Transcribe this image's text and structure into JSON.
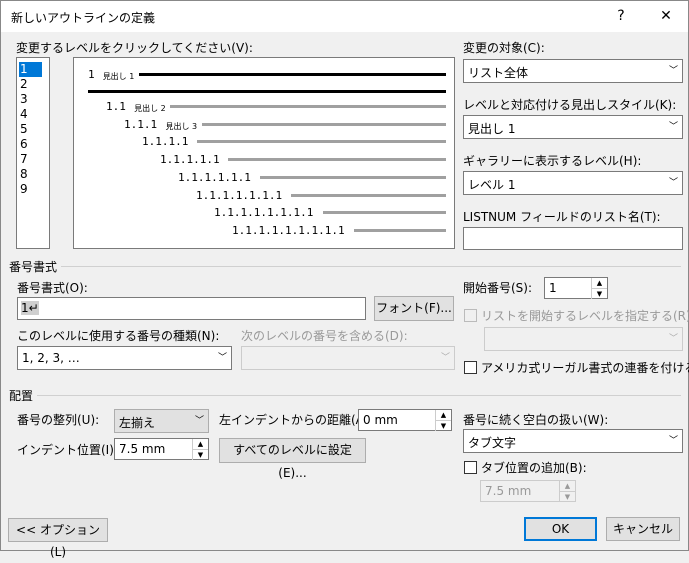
{
  "window": {
    "title": "新しいアウトラインの定義",
    "help_label": "?",
    "close_label": "✕"
  },
  "level_select": {
    "label": "変更するレベルをクリックしてください(V):",
    "levels": [
      "1",
      "2",
      "3",
      "4",
      "5",
      "6",
      "7",
      "8",
      "9"
    ]
  },
  "preview": {
    "rows": [
      {
        "num": "1",
        "head": "見出し 1",
        "style": "black"
      },
      {
        "num": "1.1",
        "head": "見出し 2",
        "style": "gray"
      },
      {
        "num": "1.1.1",
        "head": "見出し 3",
        "style": "gray"
      },
      {
        "num": "1.1.1.1",
        "head": "",
        "style": "gray"
      },
      {
        "num": "1.1.1.1.1",
        "head": "",
        "style": "gray"
      },
      {
        "num": "1.1.1.1.1.1",
        "head": "",
        "style": "gray"
      },
      {
        "num": "1.1.1.1.1.1.1",
        "head": "",
        "style": "gray"
      },
      {
        "num": "1.1.1.1.1.1.1.1",
        "head": "",
        "style": "gray"
      },
      {
        "num": "1.1.1.1.1.1.1.1.1",
        "head": "",
        "style": "gray"
      }
    ]
  },
  "right_panel": {
    "apply_to_label": "変更の対象(C):",
    "apply_to_value": "リスト全体",
    "link_style_label": "レベルと対応付ける見出しスタイル(K):",
    "link_style_value": "見出し 1",
    "gallery_level_label": "ギャラリーに表示するレベル(H):",
    "gallery_level_value": "レベル 1",
    "listnum_label": "LISTNUM フィールドのリスト名(T):",
    "listnum_value": ""
  },
  "number_format": {
    "group_label": "番号書式",
    "format_label": "番号書式(O):",
    "format_value": "1↵",
    "font_button": "フォント(F)...",
    "style_label": "このレベルに使用する番号の種類(N):",
    "style_value": "1, 2, 3, …",
    "include_label": "次のレベルの番号を含める(D):",
    "include_value": "",
    "start_label": "開始番号(S):",
    "start_value": "1",
    "restart_label": "リストを開始するレベルを指定する(R):",
    "restart_value": "",
    "legal_label": "アメリカ式リーガル書式の連番を付ける(G)"
  },
  "position": {
    "group_label": "配置",
    "align_label": "番号の整列(U):",
    "align_value": "左揃え",
    "indent_at_label": "左インデントからの距離(A):",
    "indent_at_value": "0 mm",
    "text_indent_label": "インデント位置(I):",
    "text_indent_value": "7.5 mm",
    "set_all_button": "すべてのレベルに設定(E)...",
    "follow_label": "番号に続く空白の扱い(W):",
    "follow_value": "タブ文字",
    "add_tab_label": "タブ位置の追加(B):",
    "tab_value": "7.5 mm"
  },
  "footer": {
    "options_button": "<< オプション(L)",
    "ok_button": "OK",
    "cancel_button": "キャンセル"
  }
}
